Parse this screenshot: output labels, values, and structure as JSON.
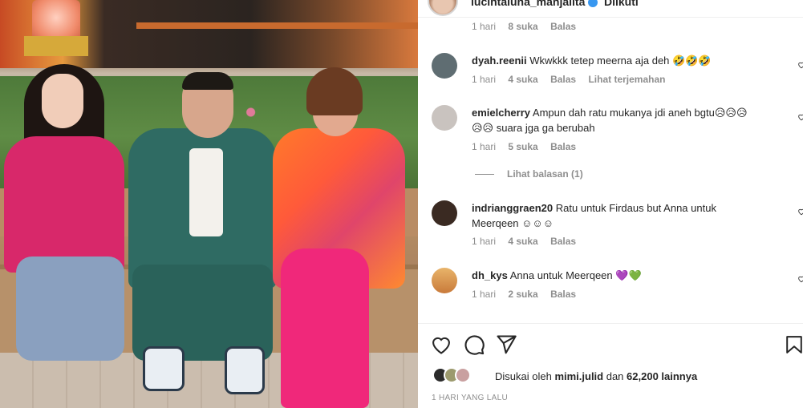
{
  "header": {
    "username": "lucintaluna_manjalita",
    "follow_status": "Diikuti"
  },
  "top_meta": {
    "time": "1 hari",
    "likes": "8 suka",
    "reply": "Balas"
  },
  "comments": [
    {
      "user": "dyah.reenii",
      "text": "Wkwkkk tetep meerna aja deh 🤣🤣🤣",
      "time": "1 hari",
      "likes": "4 suka",
      "reply": "Balas",
      "translate": "Lihat terjemahan",
      "avatar_color": "#5f6d72"
    },
    {
      "user": "emielcherry",
      "text": "Ampun dah ratu mukanya jdi aneh bgtu😥😥😥",
      "text2": "😥😥 suara jga ga berubah",
      "time": "1 hari",
      "likes": "5 suka",
      "reply": "Balas",
      "avatar_color": "#c9c3bf"
    },
    {
      "user": "indrianggraen20",
      "text": "Ratu untuk Firdaus but Anna untuk",
      "text2": "Meerqeen ☺☺☺",
      "time": "1 hari",
      "likes": "4 suka",
      "reply": "Balas",
      "avatar_color": "#3a2a22"
    },
    {
      "user": "dh_kys",
      "text": "Anna untuk Meerqeen 💜💚",
      "time": "1 hari",
      "likes": "2 suka",
      "reply": "Balas",
      "avatar_color": "#e0a25a"
    }
  ],
  "view_replies": "Lihat balasan (1)",
  "likes_line": {
    "prefix": "Disukai oleh ",
    "user": "mimi.julid",
    "middle": " dan ",
    "count": "62,200 lainnya"
  },
  "post_date": "1 HARI YANG LALU",
  "icons": [
    "heart-icon",
    "comment-icon",
    "share-icon",
    "bookmark-icon"
  ],
  "colors": {
    "verified": "#3897f0",
    "meta_text": "#8e8e8e",
    "text": "#262626"
  }
}
